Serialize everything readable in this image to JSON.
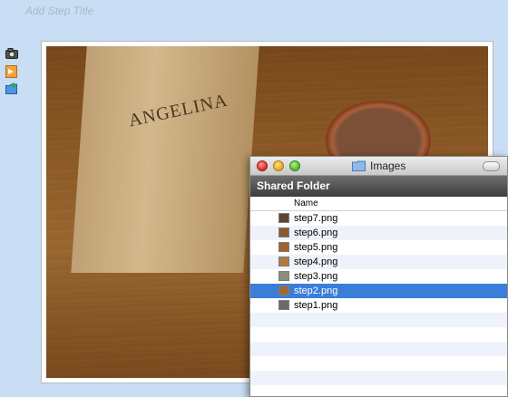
{
  "step_title_placeholder": "Add Step Title",
  "tools": [
    {
      "icon": "camera-icon"
    },
    {
      "icon": "document-icon"
    },
    {
      "icon": "folder-add-icon"
    }
  ],
  "photo": {
    "bag_brand": "ANGELINA"
  },
  "finder": {
    "title": "Images",
    "folder_icon": "folder-icon",
    "header": "Shared Folder",
    "column_name": "Name",
    "files": [
      {
        "name": "step7.png",
        "selected": false,
        "thumb_color": "#5a4632"
      },
      {
        "name": "step6.png",
        "selected": false,
        "thumb_color": "#8a5a2a"
      },
      {
        "name": "step5.png",
        "selected": false,
        "thumb_color": "#a06030"
      },
      {
        "name": "step4.png",
        "selected": false,
        "thumb_color": "#b07a40"
      },
      {
        "name": "step3.png",
        "selected": false,
        "thumb_color": "#8c8c7a"
      },
      {
        "name": "step2.png",
        "selected": true,
        "thumb_color": "#9a6a3a"
      },
      {
        "name": "step1.png",
        "selected": false,
        "thumb_color": "#6a6a6a"
      }
    ],
    "selection_color": "#3a7ed9"
  }
}
